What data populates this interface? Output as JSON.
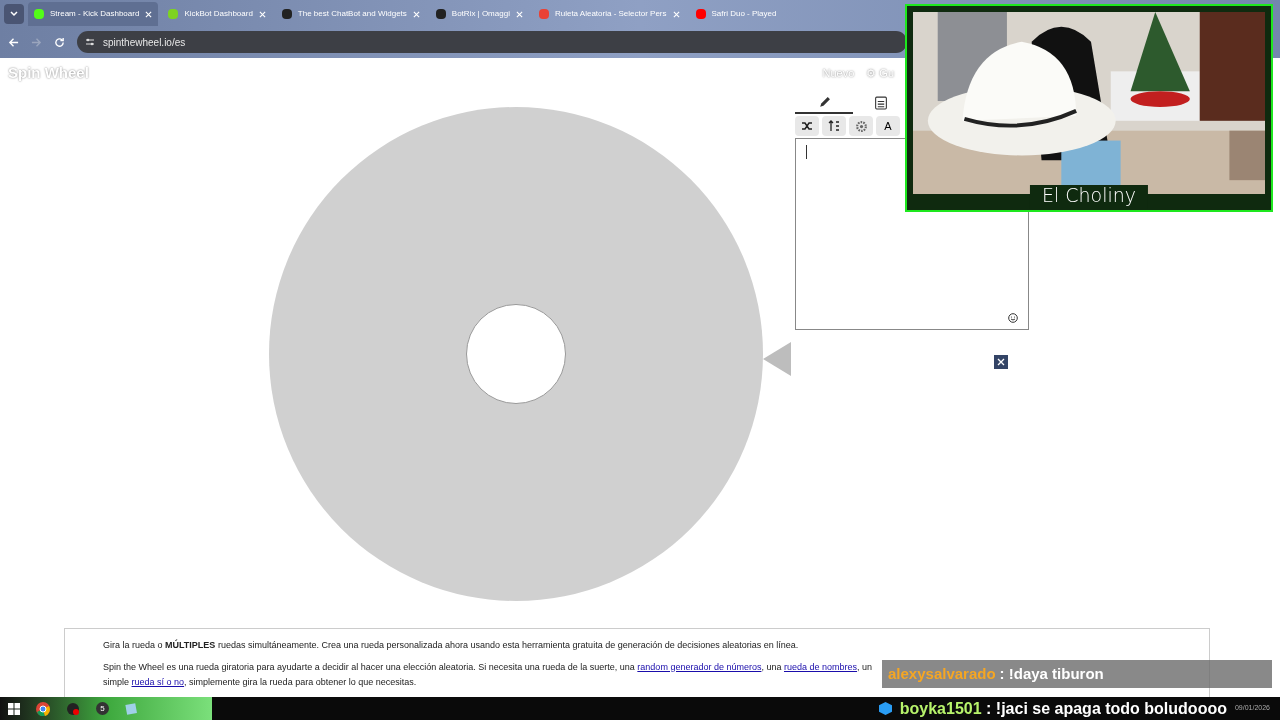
{
  "browser": {
    "tabs": [
      {
        "title": "Stream - Kick Dashboard",
        "selected": true,
        "color": "#53fc18"
      },
      {
        "title": "KickBot Dashboard",
        "selected": false,
        "color": "#7ed321"
      },
      {
        "title": "The best ChatBot and Widgets",
        "selected": false,
        "color": "#222222"
      },
      {
        "title": "BotRix | Omaggi",
        "selected": false,
        "color": "#222222"
      },
      {
        "title": "Ruleta Aleatoria - Selector Pers",
        "selected": false,
        "color": "#e94235"
      },
      {
        "title": "Safri Duo - Played",
        "selected": false,
        "color": "#ff0000"
      }
    ],
    "url": "spinthewheel.io/es"
  },
  "site": {
    "logo": "Spin Wheel",
    "nav": [
      "Nuevo",
      "⚙ Gu"
    ]
  },
  "editor": {
    "tabs": [
      {
        "kind": "pencil",
        "selected": true
      },
      {
        "kind": "list",
        "selected": false
      }
    ],
    "tools": [
      {
        "kind": "shuffle"
      },
      {
        "kind": "sort"
      },
      {
        "kind": "gear"
      },
      {
        "kind": "text",
        "label": "A"
      }
    ]
  },
  "webcam": {
    "name": "El Choliny"
  },
  "info": {
    "line1": "Gira la rueda o **MÚLTIPLES** ruedas simultáneamente. Crea una rueda personalizada ahora usando esta herramienta gratuita de generación de decisiones aleatorias en línea.",
    "line2_start": "Spin the Wheel es una rueda giratoria para ayudarte a decidir al hacer una elección aleatoria. Si necesita una rueda de la suerte, una",
    "link1": "random generador de números",
    "sep1": ", una",
    "link2": "rueda de nombres",
    "sep2": ", un",
    "line3_start": "simple",
    "link3": "rueda sí o no",
    "line3_end": ", simplemente gira la rueda para obtener lo que necesitas."
  },
  "chat": [
    {
      "user": "alexysalvarado",
      "message": ": !daya tiburon",
      "color": "#f5a623"
    },
    {
      "user": "boyka1501",
      "message": ": !jaci se apaga todo boludoooo",
      "color": "#b7f36b"
    }
  ],
  "taskbar": {
    "badge": "5",
    "date": "09/01/2026"
  }
}
